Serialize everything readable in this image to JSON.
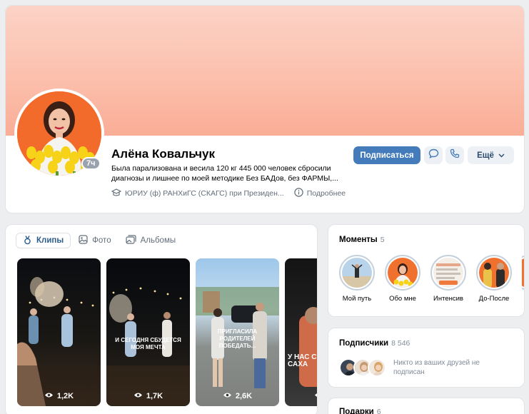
{
  "profile": {
    "name": "Алёна Ковальчук",
    "status": "Была парализована и весила 120 кг 445 000 человек сбросили диагнозы и лишнее по моей методике Без БАДов, без ФАРМЫ,...",
    "online": "7ч",
    "education": "ЮРИУ (ф) РАНХиГС (СКАГС) при Президен...",
    "details": "Подробнее",
    "subscribe_label": "Подписаться",
    "more_label": "Ещё"
  },
  "media": {
    "tabs": [
      {
        "label": "Клипы",
        "icon": "clips-icon",
        "active": true
      },
      {
        "label": "Фото",
        "icon": "photo-icon",
        "active": false
      },
      {
        "label": "Альбомы",
        "icon": "albums-icon",
        "active": false
      }
    ],
    "clips": [
      {
        "views": "1,2K",
        "caption": ""
      },
      {
        "views": "1,7K",
        "caption": "И сегодня сбудется моя мечта"
      },
      {
        "views": "2,6K",
        "caption": "Пригласила родителей победать..."
      },
      {
        "views": "",
        "caption": "У нас с САХА"
      }
    ]
  },
  "moments": {
    "title": "Моменты",
    "count": "5",
    "items": [
      {
        "label": "Мой путь"
      },
      {
        "label": "Обо мне"
      },
      {
        "label": "Интенсив"
      },
      {
        "label": "До-После"
      }
    ]
  },
  "followers": {
    "title": "Подписчики",
    "count": "8 546",
    "note": "Никто из ваших друзей не подписан"
  },
  "gifts": {
    "title": "Подарки",
    "count": "6"
  },
  "colors": {
    "accent": "#447bba",
    "cover": "#fcc0ad",
    "avatar_bg": "#f26b2a"
  }
}
